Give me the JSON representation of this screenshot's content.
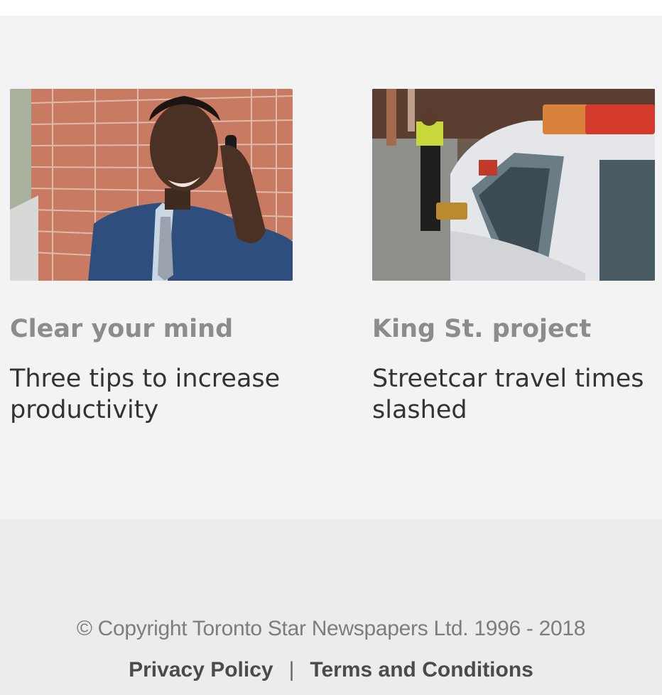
{
  "cards": [
    {
      "kicker": "Clear your mind",
      "headline": "Three tips to increase productivity",
      "image": "man-on-phone-photo"
    },
    {
      "kicker": "King St. project",
      "headline": "Streetcar travel times slashed",
      "image": "police-car-street-photo"
    }
  ],
  "footer": {
    "copyright": "© Copyright Toronto Star Newspapers Ltd. 1996 - 2018",
    "privacy_label": "Privacy Policy",
    "separator": "|",
    "terms_label": "Terms and Conditions"
  },
  "colors": {
    "background": "#f2f2f2",
    "kicker": "#8c8c8c",
    "headline": "#333333",
    "footer_bg": "#ececec"
  }
}
